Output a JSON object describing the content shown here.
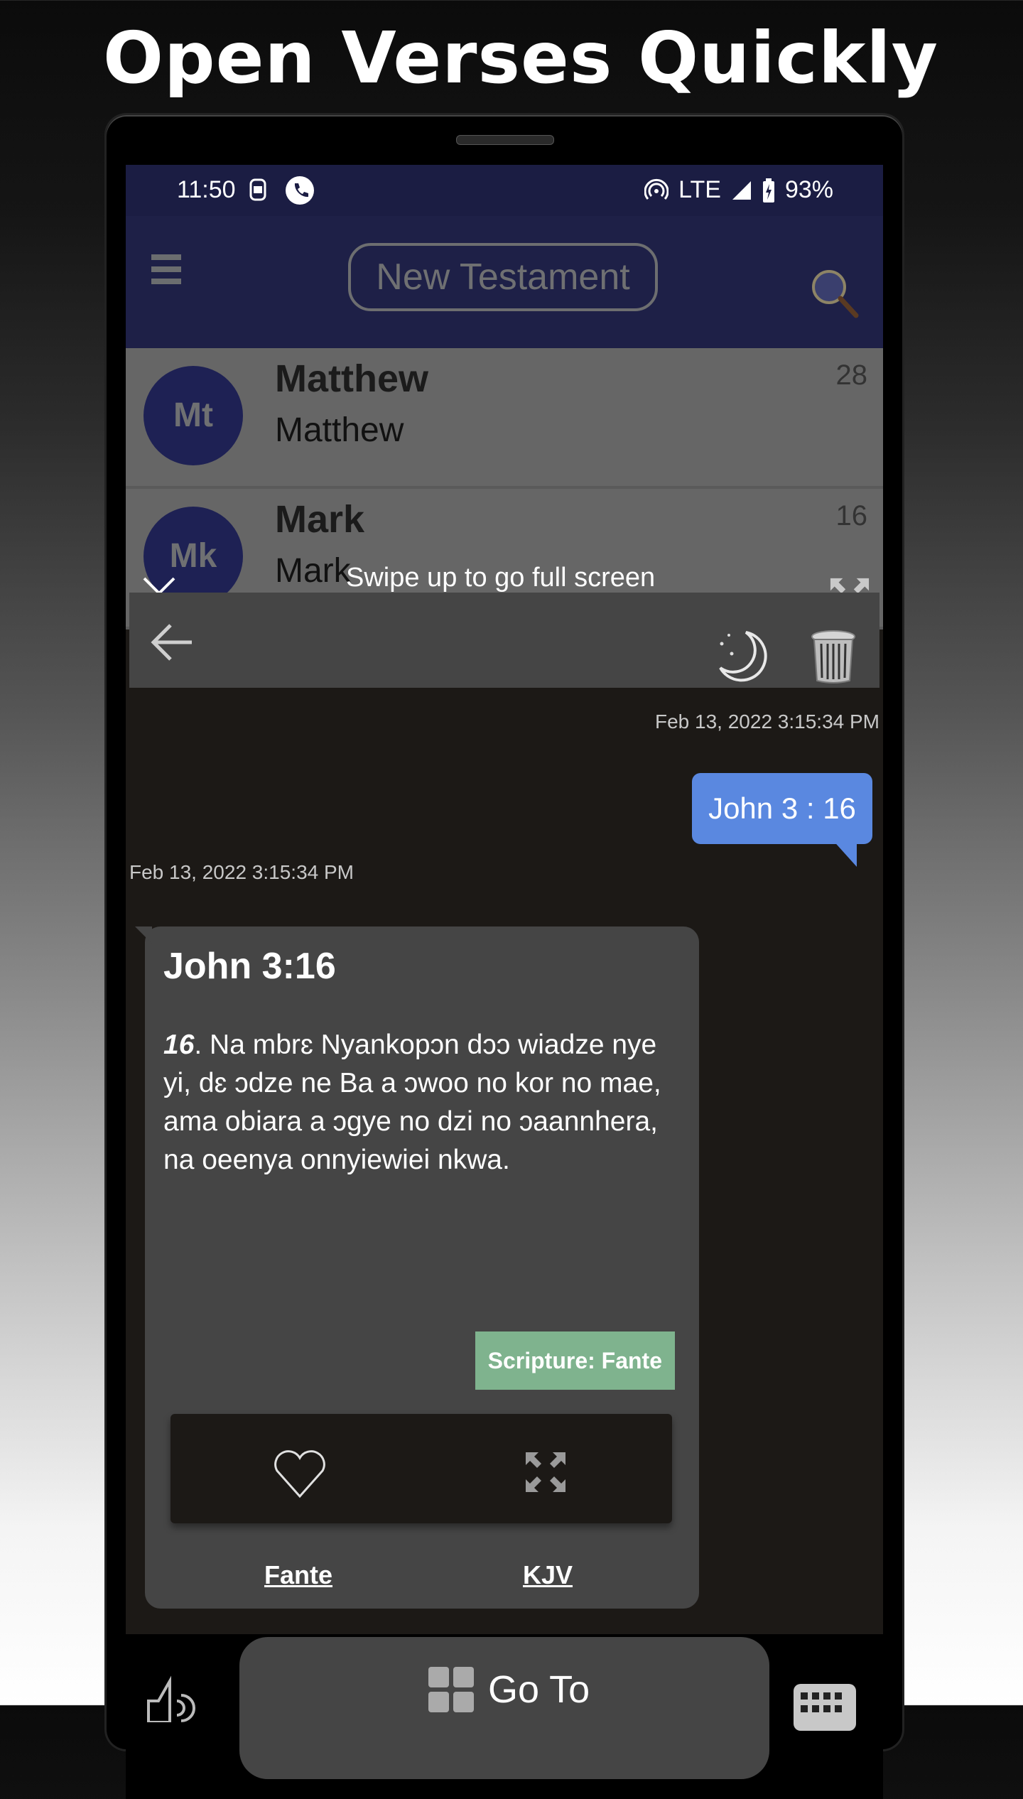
{
  "headline": "Open Verses Quickly",
  "status_bar": {
    "time": "11:50",
    "network": "LTE",
    "battery": "93%",
    "icons": [
      "sim-icon",
      "call-icon",
      "hotspot-icon",
      "signal-icon",
      "battery-charging-icon"
    ]
  },
  "app_bar": {
    "menu_icon": "hamburger-icon",
    "testament_label": "New Testament",
    "search_icon": "magnifier-icon"
  },
  "books": [
    {
      "abbr": "Mt",
      "title": "Matthew",
      "subtitle": "Matthew",
      "chapters": "28"
    },
    {
      "abbr": "Mk",
      "title": "Mark",
      "subtitle": "Mark",
      "chapters": "16"
    }
  ],
  "overlay": {
    "swipe_hint": "Swipe up to go full screen"
  },
  "chat": {
    "toolbar_icons": [
      "back-arrow-icon",
      "moon-icon",
      "trash-icon"
    ],
    "sent_timestamp": "Feb 13, 2022 3:15:34 PM",
    "sent_message": "John 3 : 16",
    "received_timestamp": "Feb 13, 2022 3:15:34 PM",
    "verse_card": {
      "reference": "John 3:16",
      "verse_number": "16",
      "verse_text": ". Na mbrɛ Nyankopɔn dɔɔ wiadze nye yi, dɛ ɔdze ne Ba a ɔwoo no kor no mae, ama obiara a ɔgye no dzi no ɔaannhera, na oeenya onnyiewiei nkwa.",
      "scripture_badge": "Scripture: Fante",
      "actions": [
        "heart-icon",
        "expand-icon"
      ],
      "translations": [
        "Fante",
        "KJV"
      ]
    }
  },
  "bottom_bar": {
    "goto_label": "Go To",
    "left_icon": "speaker-icon",
    "right_icon": "keyboard-icon"
  },
  "colors": {
    "status_bar_bg": "#1b1d43",
    "app_bar_bg": "#1e2047",
    "avatar_bg": "#1e2154",
    "sent_bubble": "#5a88e0",
    "scripture_badge": "#7fb38e",
    "card_bg": "#454545",
    "chat_bg": "#1c1916"
  }
}
